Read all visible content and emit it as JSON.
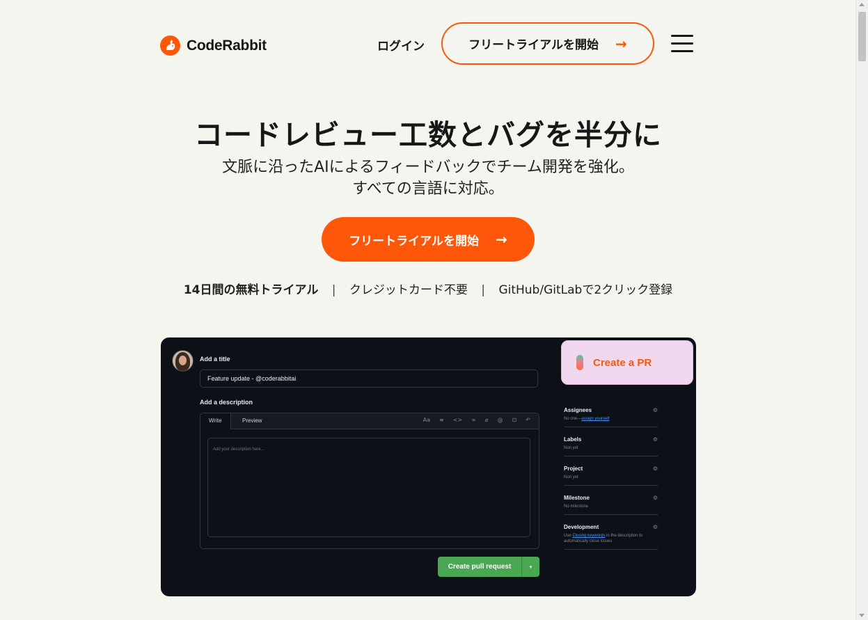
{
  "header": {
    "brand": "CodeRabbit",
    "login": "ログイン",
    "cta": "フリートライアルを開始",
    "cta_arrow": "→"
  },
  "hero": {
    "title": "コードレビュー工数とバグを半分に",
    "subtitle_line1": "文脈に沿ったAIによるフィードバックでチーム開発を強化。",
    "subtitle_line2": "すべての言語に対応。",
    "cta": "フリートライアルを開始",
    "cta_arrow": "→",
    "features": [
      "14日間の無料トライアル",
      "クレジットカード不要",
      "GitHub/GitLabで2クリック登録"
    ],
    "separator": "|"
  },
  "demo": {
    "add_title_label": "Add a title",
    "title_value": "Feature update - @coderabbitai",
    "add_description_label": "Add a description",
    "tabs": [
      "Write",
      "Preview"
    ],
    "toolbar_icons": [
      "heading-icon",
      "list-icon",
      "code-icon",
      "link-icon",
      "attach-icon",
      "mention-icon",
      "reference-icon",
      "undo-icon"
    ],
    "description_placeholder": "Add your description here...",
    "submit_label": "Create pull request",
    "submit_caret": "▾",
    "create_pr_label": "Create a PR",
    "sidebar": {
      "assignees": {
        "title": "Assignees",
        "text": "No one—",
        "link": "assign yourself"
      },
      "labels": {
        "title": "Labels",
        "text": "Non yet"
      },
      "project": {
        "title": "Project",
        "text": "Non yet"
      },
      "milestone": {
        "title": "Milestone",
        "text": "No milestone"
      },
      "development": {
        "title": "Development",
        "text_pre": "Use ",
        "link": "Closing keywords",
        "text_post": " in the description to automatically close issues"
      }
    }
  },
  "colors": {
    "accent": "#ff570a",
    "background": "#f5f5ef",
    "panel": "#0d1117",
    "submit": "#4aa752",
    "pr_card": "#f2d8ee"
  }
}
